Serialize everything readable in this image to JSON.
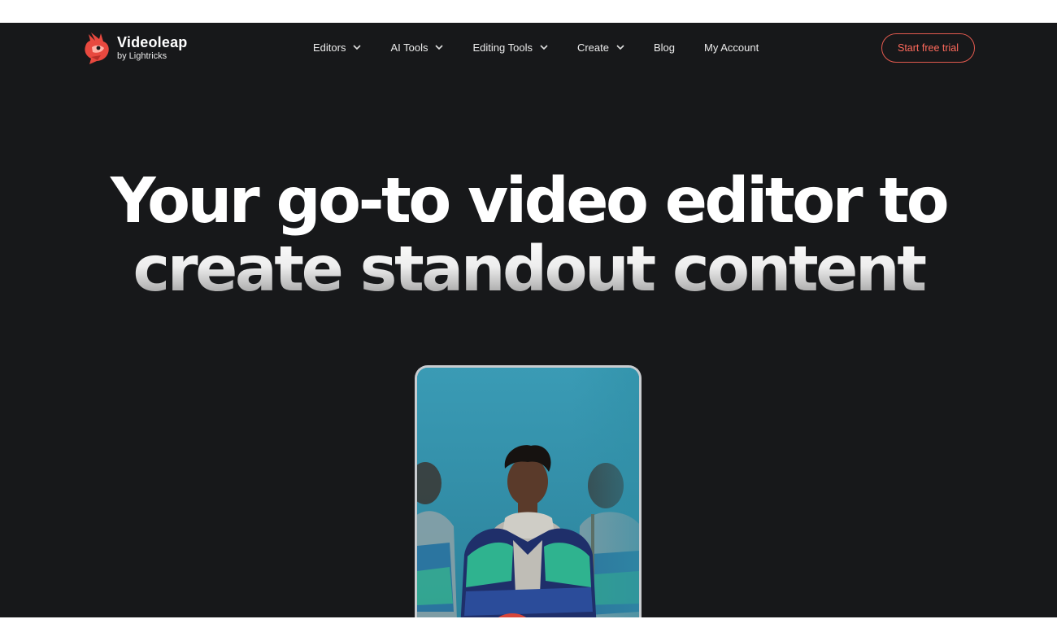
{
  "brand": {
    "name": "Videoleap",
    "byline": "by Lightricks",
    "accent_color": "#e25a4f",
    "logo_icon": "bird-logo-icon"
  },
  "nav": {
    "items": [
      {
        "label": "Editors",
        "has_dropdown": true
      },
      {
        "label": "AI Tools",
        "has_dropdown": true
      },
      {
        "label": "Editing Tools",
        "has_dropdown": true
      },
      {
        "label": "Create",
        "has_dropdown": true
      },
      {
        "label": "Blog",
        "has_dropdown": false
      },
      {
        "label": "My Account",
        "has_dropdown": false
      }
    ],
    "cta_label": "Start free trial"
  },
  "hero": {
    "line1": "Your go-to video editor to",
    "line2": "create standout content"
  },
  "preview": {
    "kind": "video-preview",
    "background_color": "#2f8fa6"
  },
  "colors": {
    "page_background": "#17181a",
    "text": "#ffffff"
  }
}
